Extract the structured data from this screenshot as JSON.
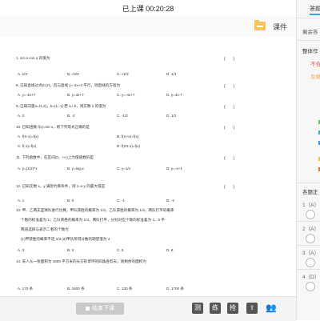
{
  "header": {
    "timer": "已上课 00:20:28"
  },
  "course": {
    "label": "课件",
    "icon": "folder-icon"
  },
  "document": {
    "questions": [
      {
        "num": "1.",
        "text": "sin α cos α 的值为"
      },
      {
        "num": "8.",
        "text": "已知直线过点(0,2)，且与直线 y=-4x+3 平行，则直线的方程为"
      },
      {
        "num": "9.",
        "text": "已知向量a=(1,2)，b=(1,-1) 若 a⊥b，则实数 λ 的值为"
      },
      {
        "num": "10.",
        "text": "已知函数 f(x)=sin x，则下列等式正确的是"
      },
      {
        "num": "11.",
        "text": "下列函数中，在区间(0，+∞)上为增函数的是"
      },
      {
        "num": "12.",
        "text": "已知实数 x，y 满足约束条件，则 z=x-y 的最大值是"
      },
      {
        "num": "13.",
        "text": "甲、乙两支篮球队进行比赛，甲队获胜的概率为 1/3，乙队获胜的概率为 1/4，两队打平的概率"
      },
      {
        "num": "14.",
        "text": "某人从一张面积为 1500 平方米的长方形草坪的四角各剪去，则剩余的面积为"
      }
    ],
    "options": [
      [
        "A. 1/2",
        "B. √3/2",
        "C. √2/2",
        "D. 1/4"
      ],
      [
        "A. y=-4x+7",
        "B. y=4x+7",
        "C. y=-4x+7",
        "D. y=4x-7"
      ],
      [
        "A. 2",
        "B. -2",
        "C. -1/2",
        "D. 1/2"
      ],
      [
        "A. f(π-x)=f(x)",
        "B. f(π+x)=f(x)"
      ],
      [
        "C. f(-x)=f(x)",
        "D. f(2π-x)=f(x)"
      ],
      [
        "A. y=(1/2)^x",
        "B. y=log₂x",
        "C. y=1/x",
        "D. y=-x+1"
      ],
      [
        "A. 1",
        "B. 0",
        "C. -1",
        "D. -2"
      ],
      [
        "A. 3",
        "B. 4",
        "C. 5",
        "D. 6"
      ],
      [
        "A. 170 条",
        "B. 1600 条",
        "C. 130 条",
        "D. 1700 条"
      ]
    ],
    "notes": [
      "个数的标准差为 1；乙队获胜的概率为 1/4，两队打平，分别对应个数的标准差为 4，5 平",
      "两道选择与表示二者的个数为",
      "(1)甲获胜的概率不足 2/3      (2)甲队所得分数的期望值为 4"
    ]
  },
  "bottom": {
    "end_label": "结束下课",
    "tools": [
      "测",
      "练",
      "抢"
    ]
  },
  "sidebar": {
    "tab": "答题",
    "remaining": "剩余答",
    "status_title": "整体作",
    "status_red": "不合",
    "status_orange": "及格",
    "answers_title": "各题正",
    "answers": [
      "1（A）",
      "2（A）",
      "3（A）",
      "4（D）"
    ],
    "colors": {
      "accent": "#2aa8e0",
      "red": "#e64b4b",
      "orange": "#f2a74b",
      "green": "#63c36a",
      "teal": "#36b3c6",
      "blue": "#4a8fe0",
      "yellow": "#f3c43f",
      "darkorange": "#e07a2a"
    }
  }
}
